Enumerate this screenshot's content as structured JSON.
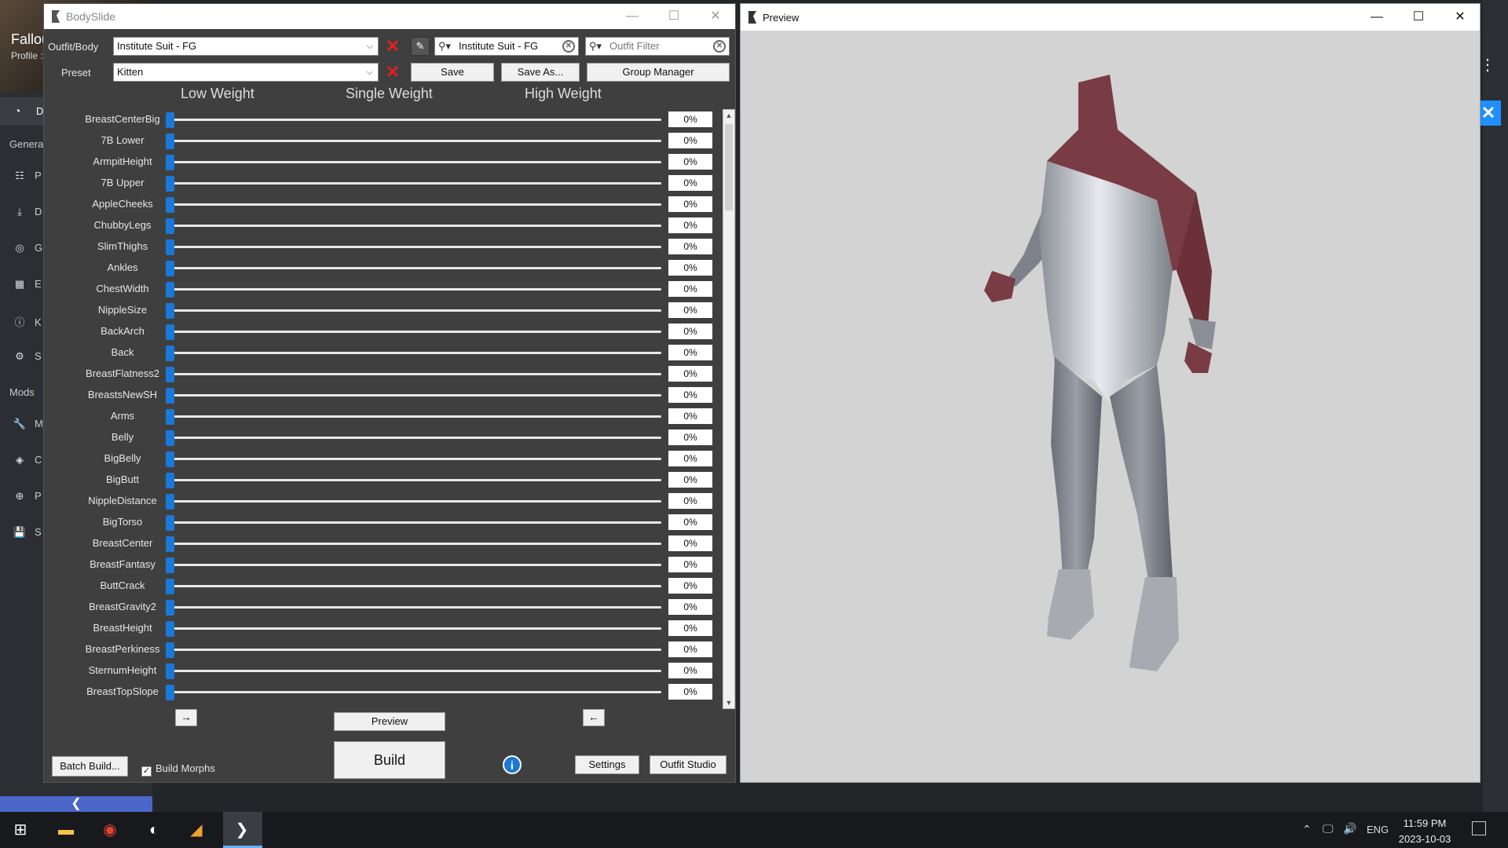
{
  "host": {
    "title": "Fallou",
    "profile": "Profile :",
    "dash_label": "D",
    "sections": [
      "General",
      "Mods"
    ],
    "items": [
      {
        "icon": "☷",
        "label": "P",
        "icon_name": "plugins-icon"
      },
      {
        "icon": "⤓",
        "label": "D",
        "icon_name": "download-icon"
      },
      {
        "icon": "◎",
        "label": "G",
        "icon_name": "game-icon"
      },
      {
        "icon": "▦",
        "label": "E",
        "icon_name": "extensions-icon"
      },
      {
        "icon": "ⓘ",
        "label": "K",
        "icon_name": "info-icon"
      },
      {
        "icon": "⚙",
        "label": "S",
        "icon_name": "settings-icon"
      },
      {
        "icon": "🔧",
        "label": "M",
        "icon_name": "wrench-icon"
      },
      {
        "icon": "◈",
        "label": "C",
        "icon_name": "layers-icon"
      },
      {
        "icon": "⊕",
        "label": "P",
        "icon_name": "plus-circle-icon"
      },
      {
        "icon": "💾",
        "label": "S",
        "icon_name": "save-icon"
      }
    ],
    "collapse_glyph": "❮",
    "close_glyph": "✕",
    "kebab_glyph": "⋮"
  },
  "bodyslide": {
    "title": "BodySlide",
    "controls": {
      "minimize": "—",
      "maximize": "☐",
      "close": "✕"
    },
    "outfit_label": "Outfit/Body",
    "outfit_value": "Institute Suit - FG",
    "preset_label": "Preset",
    "preset_value": "Kitten",
    "search_value": "Institute Suit - FG",
    "outfit_filter_placeholder": "Outfit Filter",
    "save_label": "Save",
    "save_as_label": "Save As...",
    "group_manager_label": "Group Manager",
    "col_low": "Low Weight",
    "col_single": "Single Weight",
    "col_high": "High Weight",
    "sliders": [
      {
        "name": "BreastCenterBig",
        "value": "0%"
      },
      {
        "name": "7B Lower",
        "value": "0%"
      },
      {
        "name": "ArmpitHeight",
        "value": "0%"
      },
      {
        "name": "7B Upper",
        "value": "0%"
      },
      {
        "name": "AppleCheeks",
        "value": "0%"
      },
      {
        "name": "ChubbyLegs",
        "value": "0%"
      },
      {
        "name": "SlimThighs",
        "value": "0%"
      },
      {
        "name": "Ankles",
        "value": "0%"
      },
      {
        "name": "ChestWidth",
        "value": "0%"
      },
      {
        "name": "NippleSize",
        "value": "0%"
      },
      {
        "name": "BackArch",
        "value": "0%"
      },
      {
        "name": "Back",
        "value": "0%"
      },
      {
        "name": "BreastFlatness2",
        "value": "0%"
      },
      {
        "name": "BreastsNewSH",
        "value": "0%"
      },
      {
        "name": "Arms",
        "value": "0%"
      },
      {
        "name": "Belly",
        "value": "0%"
      },
      {
        "name": "BigBelly",
        "value": "0%"
      },
      {
        "name": "BigButt",
        "value": "0%"
      },
      {
        "name": "NippleDistance",
        "value": "0%"
      },
      {
        "name": "BigTorso",
        "value": "0%"
      },
      {
        "name": "BreastCenter",
        "value": "0%"
      },
      {
        "name": "BreastFantasy",
        "value": "0%"
      },
      {
        "name": "ButtCrack",
        "value": "0%"
      },
      {
        "name": "BreastGravity2",
        "value": "0%"
      },
      {
        "name": "BreastHeight",
        "value": "0%"
      },
      {
        "name": "BreastPerkiness",
        "value": "0%"
      },
      {
        "name": "SternumHeight",
        "value": "0%"
      },
      {
        "name": "BreastTopSlope",
        "value": "0%"
      }
    ],
    "left_arrow_label": "→",
    "right_arrow_label": "←",
    "preview_label": "Preview",
    "build_label": "Build",
    "batch_build_label": "Batch Build...",
    "build_morphs_label": "Build Morphs",
    "build_morphs_checked": "✓",
    "settings_label": "Settings",
    "outfit_studio_label": "Outfit Studio",
    "info_glyph": "i",
    "clear_glyph": "✕",
    "accent_color": "#1a78d6"
  },
  "preview": {
    "title": "Preview",
    "controls": {
      "minimize": "—",
      "maximize": "☐",
      "close": "✕"
    }
  },
  "taskbar": {
    "time": "11:59 PM",
    "date": "2023-10-03",
    "language": "ENG",
    "start_glyph": "⊞",
    "icons": [
      "file-explorer-icon",
      "chrome-icon",
      "paint-icon",
      "app-icon",
      "bodyslide-icon"
    ]
  }
}
